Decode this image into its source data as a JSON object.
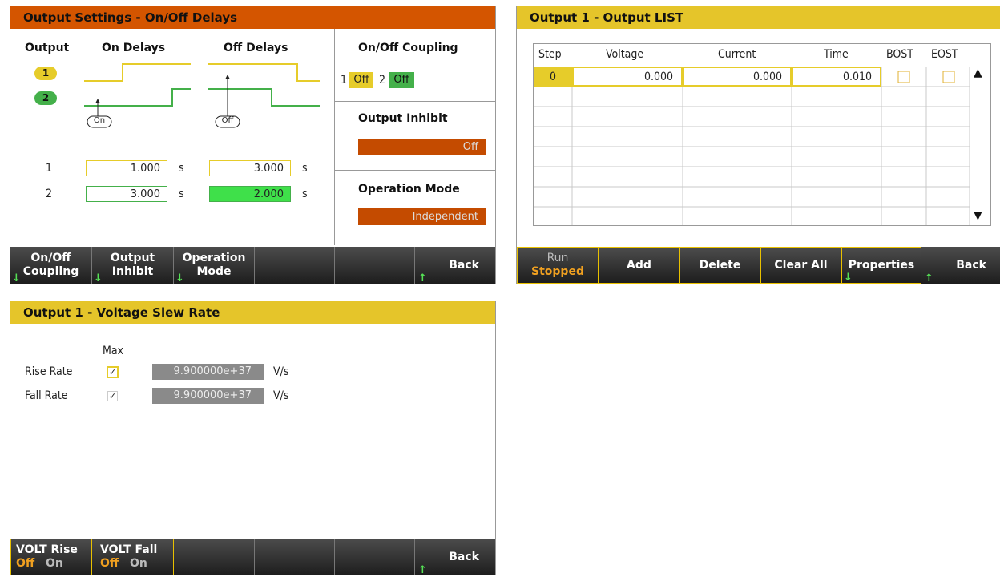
{
  "delays": {
    "title": "Output Settings - On/Off Delays",
    "col_output": "Output",
    "col_on": "On Delays",
    "col_off": "Off Delays",
    "badge1": "1",
    "badge2": "2",
    "marker_on": "On",
    "marker_off": "Off",
    "rows": [
      {
        "num": "1",
        "on": "1.000",
        "on_unit": "s",
        "off": "3.000",
        "off_unit": "s"
      },
      {
        "num": "2",
        "on": "3.000",
        "on_unit": "s",
        "off": "2.000",
        "off_unit": "s"
      }
    ],
    "coupling_title": "On/Off Coupling",
    "coupling": {
      "n1": "1",
      "v1": "Off",
      "n2": "2",
      "v2": "Off"
    },
    "inhibit_title": "Output Inhibit",
    "inhibit_value": "Off",
    "mode_title": "Operation Mode",
    "mode_value": "Independent",
    "softkeys": [
      {
        "l1": "On/Off",
        "l2": "Coupling"
      },
      {
        "l1": "Output",
        "l2": "Inhibit"
      },
      {
        "l1": "Operation",
        "l2": "Mode"
      },
      {
        "l1": "",
        "l2": ""
      },
      {
        "l1": "",
        "l2": ""
      },
      {
        "l1": "Back",
        "l2": ""
      }
    ],
    "colors": {
      "title_bg": "#d45500",
      "yellow": "#e6cc2a",
      "green": "#44b04a",
      "orange_field": "#c44b00"
    }
  },
  "list": {
    "title": "Output 1 - Output LIST",
    "headers": [
      "Step",
      "Voltage",
      "Current",
      "Time",
      "BOST",
      "EOST"
    ],
    "row0": {
      "step": "0",
      "voltage": "0.000",
      "current": "0.000",
      "time": "0.010"
    },
    "softkeys": {
      "run_l1": "Run",
      "run_l2": "Stopped",
      "add": "Add",
      "delete": "Delete",
      "clear": "Clear All",
      "properties": "Properties",
      "back": "Back"
    },
    "scroll_up": "▲",
    "scroll_down": "▼",
    "colors": {
      "title_bg": "#e5c52a"
    }
  },
  "slew": {
    "title": "Output 1 - Voltage Slew Rate",
    "max_label": "Max",
    "rise_label": "Rise Rate",
    "fall_label": "Fall Rate",
    "rise_value": "9.900000e+37",
    "fall_value": "9.900000e+37",
    "unit": "V/s",
    "check_mark": "✓",
    "softkeys": {
      "rise_l1": "VOLT Rise",
      "rise_off": "Off",
      "rise_on": "On",
      "fall_l1": "VOLT Fall",
      "fall_off": "Off",
      "fall_on": "On",
      "back": "Back"
    },
    "colors": {
      "title_bg": "#e5c52a",
      "value_bg": "#8a8a8a"
    }
  }
}
